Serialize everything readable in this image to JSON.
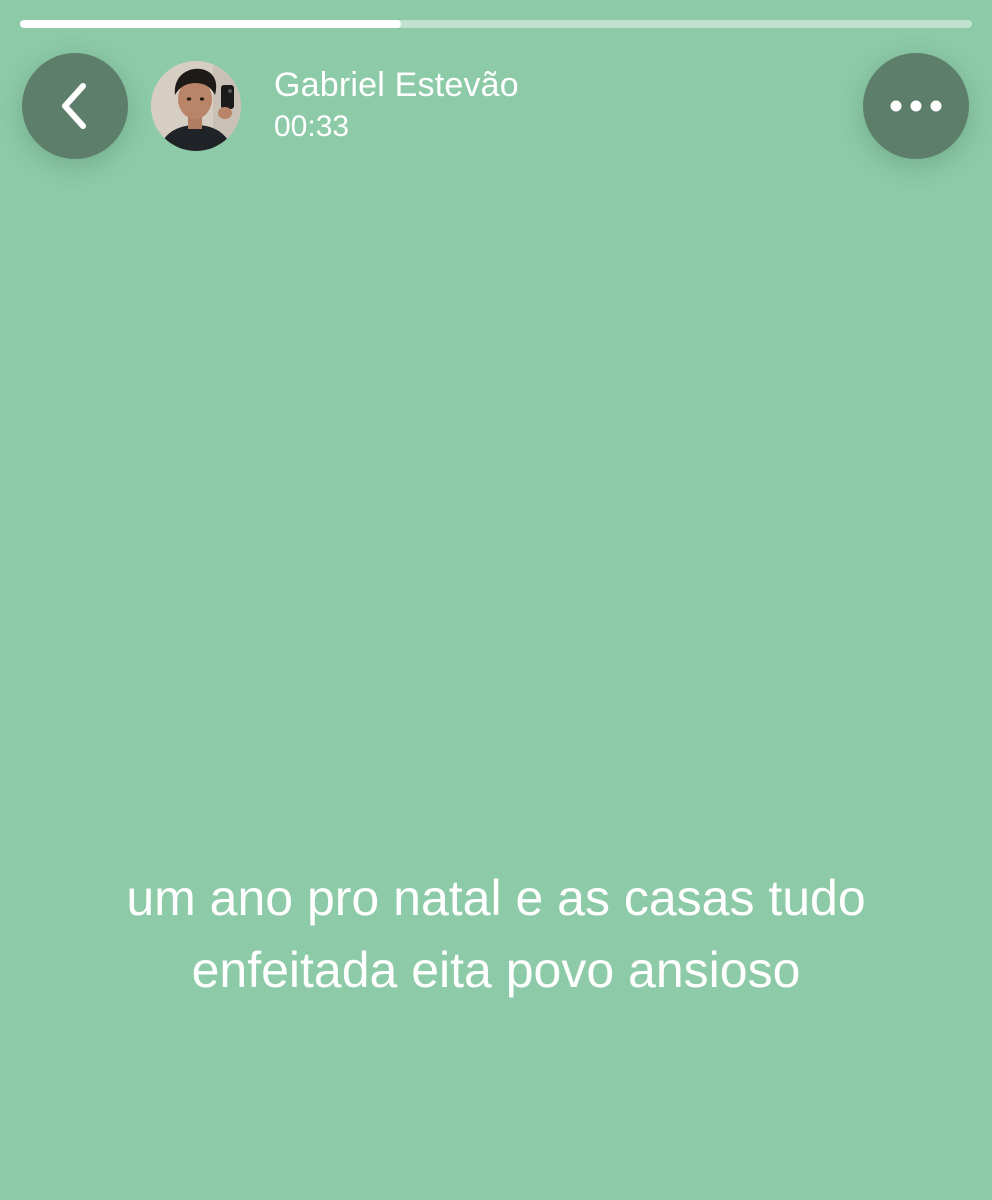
{
  "story": {
    "background_color": "#8dcaa8",
    "progress_fraction": 0.4,
    "author": {
      "name": "Gabriel Estevão",
      "time": "00:33"
    },
    "caption_lines": [
      "um ano pro natal e as casas tudo",
      "enfeitada eita povo ansioso"
    ]
  },
  "icons": {
    "back": "chevron-left-icon",
    "more": "more-horizontal-icon"
  }
}
